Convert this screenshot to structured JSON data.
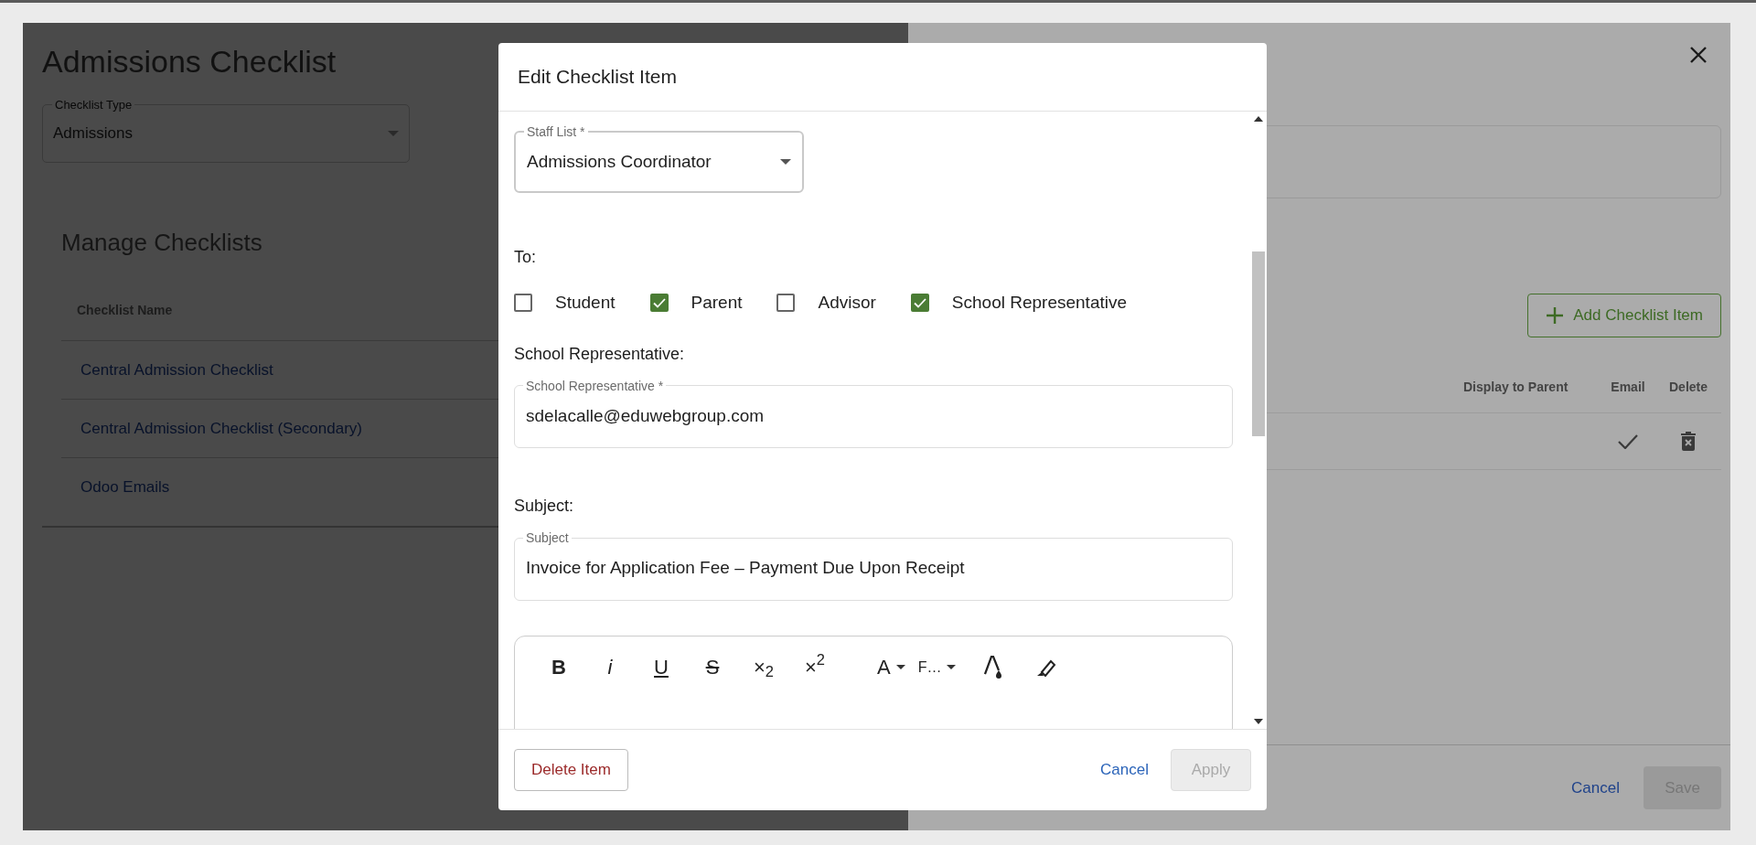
{
  "page": {
    "title": "Admissions Checklist",
    "checklist_type": {
      "label": "Checklist Type",
      "value": "Admissions"
    },
    "manage": {
      "title": "Manage Checklists",
      "column": "Checklist Name",
      "rows": [
        "Central Admission Checklist",
        "Central Admission Checklist (Secondary)",
        "Odoo Emails"
      ]
    }
  },
  "drawer": {
    "add_button": "Add Checklist Item",
    "columns": [
      "Display to Parent",
      "Email",
      "Delete"
    ],
    "rows": [
      {
        "email": true
      }
    ],
    "cancel": "Cancel",
    "save": "Save"
  },
  "modal": {
    "title": "Edit Checklist Item",
    "staff_list": {
      "label": "Staff List *",
      "value": "Admissions Coordinator"
    },
    "to_label": "To:",
    "recipients": [
      {
        "label": "Student",
        "checked": false
      },
      {
        "label": "Parent",
        "checked": true
      },
      {
        "label": "Advisor",
        "checked": false
      },
      {
        "label": "School Representative",
        "checked": true
      }
    ],
    "rep_heading": "School Representative:",
    "rep_field": {
      "label": "School Representative *",
      "value": "sdelacalle@eduwebgroup.com"
    },
    "subject_heading": "Subject:",
    "subject_field": {
      "label": "Subject",
      "value": "Invoice for Application Fee – Payment Due Upon Receipt"
    },
    "toolbar": [
      {
        "kind": "bold",
        "text": "B"
      },
      {
        "kind": "italic",
        "text": "i"
      },
      {
        "kind": "underline",
        "text": "U"
      },
      {
        "kind": "strike",
        "text": "S"
      },
      {
        "kind": "script",
        "text": "×$_{2}$"
      },
      {
        "kind": "script",
        "text": "×$^{2}$"
      },
      {
        "kind": "dropdown",
        "text": "A"
      },
      {
        "kind": "dropdown",
        "text": "F…"
      },
      {
        "kind": "color"
      },
      {
        "kind": "highlight"
      }
    ],
    "delete": "Delete Item",
    "cancel": "Cancel",
    "apply": "Apply",
    "apply_disabled": true
  }
}
